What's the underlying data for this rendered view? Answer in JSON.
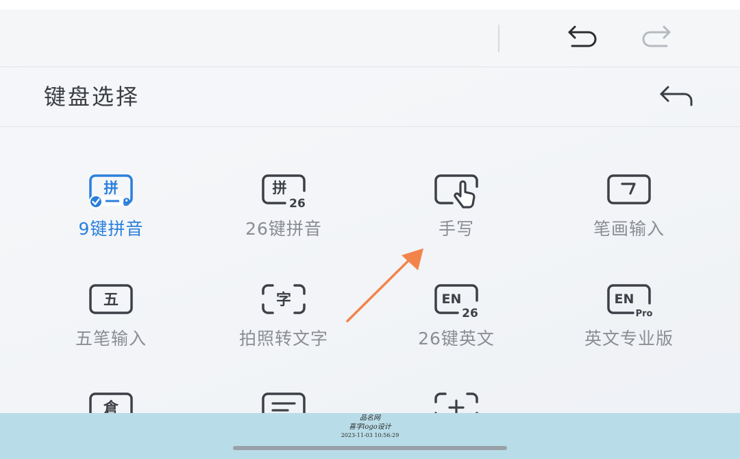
{
  "toolbar": {
    "undo_icon": "undo-icon",
    "redo_icon": "redo-icon"
  },
  "header": {
    "title": "键盘选择",
    "back_icon": "back-arrow-icon"
  },
  "keyboards": [
    {
      "label": "9键拼音",
      "icon_text": "拼",
      "icon_sub": "9",
      "icon": "pinyin-9-icon",
      "selected": true
    },
    {
      "label": "26键拼音",
      "icon_text": "拼",
      "icon_sub": "26",
      "icon": "pinyin-26-icon",
      "selected": false
    },
    {
      "label": "手写",
      "icon": "handwriting-icon",
      "selected": false
    },
    {
      "label": "笔画输入",
      "icon_text": "㇆",
      "icon": "stroke-icon",
      "selected": false
    },
    {
      "label": "五笔输入",
      "icon_text": "五",
      "icon": "wubi-icon",
      "selected": false
    },
    {
      "label": "拍照转文字",
      "icon_text": "字",
      "icon": "photo-to-text-icon",
      "selected": false
    },
    {
      "label": "26键英文",
      "icon_text": "EN",
      "icon_sub": "26",
      "icon": "english-26-icon",
      "selected": false
    },
    {
      "label": "英文专业版",
      "icon_text": "EN",
      "icon_sub": "Pro",
      "icon": "english-pro-icon",
      "selected": false
    },
    {
      "icon_text": "倉",
      "icon": "cangjie-icon"
    },
    {
      "icon": "keyboard-text-icon"
    },
    {
      "icon": "add-keyboard-icon"
    }
  ],
  "colors": {
    "accent": "#2a7fdc",
    "icon_gray": "#3d4046",
    "label_gray": "#8a8d93",
    "annotation_arrow": "#f2844a",
    "bottom_band": "#b9dde8"
  },
  "watermark": {
    "line1": "品名网",
    "line2": "喜字logo设计",
    "line3": "2023-11-03 10:56:29"
  }
}
